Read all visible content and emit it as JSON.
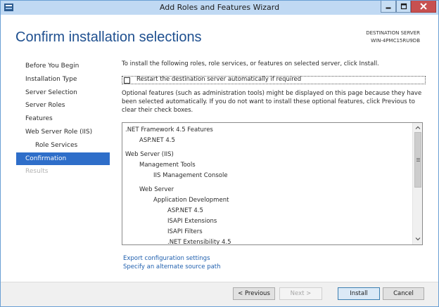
{
  "window": {
    "title": "Add Roles and Features Wizard"
  },
  "header": {
    "page_title": "Confirm installation selections",
    "destination_label": "DESTINATION SERVER",
    "destination_name": "WIN-4PMC15RU9DB"
  },
  "nav": {
    "items": [
      {
        "label": "Before You Begin",
        "state": "normal"
      },
      {
        "label": "Installation Type",
        "state": "normal"
      },
      {
        "label": "Server Selection",
        "state": "normal"
      },
      {
        "label": "Server Roles",
        "state": "normal"
      },
      {
        "label": "Features",
        "state": "normal"
      },
      {
        "label": "Web Server Role (IIS)",
        "state": "normal"
      },
      {
        "label": "Role Services",
        "state": "sub"
      },
      {
        "label": "Confirmation",
        "state": "selected"
      },
      {
        "label": "Results",
        "state": "disabled"
      }
    ]
  },
  "content": {
    "intro": "To install the following roles, role services, or features on selected server, click Install.",
    "restart_label": "Restart the destination server automatically if required",
    "restart_checked": false,
    "optional_text": "Optional features (such as administration tools) might be displayed on this page because they have been selected automatically. If you do not want to install these optional features, click Previous to clear their check boxes.",
    "selections": [
      {
        "text": ".NET Framework 4.5 Features",
        "level": 0
      },
      {
        "text": "ASP.NET 4.5",
        "level": 1
      },
      {
        "text": "Web Server (IIS)",
        "level": 0
      },
      {
        "text": "Management Tools",
        "level": 1
      },
      {
        "text": "IIS Management Console",
        "level": 2
      },
      {
        "text": "Web Server",
        "level": 1
      },
      {
        "text": "Application Development",
        "level": 2
      },
      {
        "text": "ASP.NET 4.5",
        "level": 3
      },
      {
        "text": "ISAPI Extensions",
        "level": 3
      },
      {
        "text": "ISAPI Filters",
        "level": 3
      },
      {
        "text": ".NET Extensibility 4.5",
        "level": 3
      }
    ],
    "export_link": "Export configuration settings",
    "source_link": "Specify an alternate source path"
  },
  "footer": {
    "previous": "< Previous",
    "next": "Next >",
    "install": "Install",
    "cancel": "Cancel"
  },
  "colors": {
    "accent": "#2e6ec9",
    "title": "#1e4f8f",
    "link": "#1f5fae",
    "titlebar": "#c0d9f3",
    "close_button": "#c75050"
  }
}
